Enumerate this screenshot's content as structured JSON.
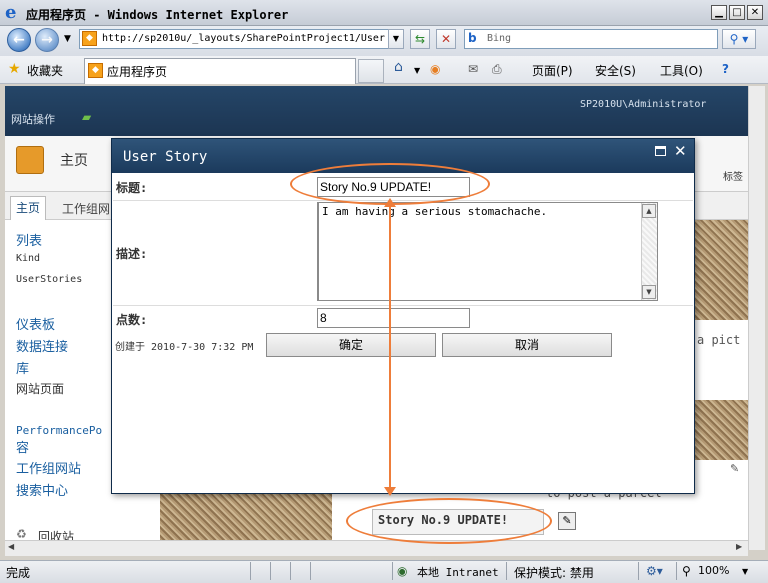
{
  "window": {
    "title": "应用程序页 - Windows Internet Explorer",
    "minimize": "▁",
    "maximize": "□",
    "close": "✕"
  },
  "nav": {
    "back": "←",
    "forward": "→",
    "address": "http://sp2010u/_layouts/SharePointProject1/User",
    "search_placeholder": "Bing"
  },
  "favorites": {
    "label": "收藏夹",
    "tab_label": "应用程序页"
  },
  "commandbar": {
    "page": "页面(P)",
    "safety": "安全(S)",
    "tools": "工具(O)"
  },
  "sharepoint": {
    "user": "SP2010U\\Administrator",
    "site_actions": "网站操作",
    "home_title": "主页",
    "tag_label": "标签",
    "tabs": [
      "主页",
      "工作组网"
    ],
    "nav_lists_header": "列表",
    "nav_lists": [
      "Kind",
      "UserStories"
    ],
    "nav_items": [
      "仪表板",
      "数据连接",
      "库",
      "网站页面"
    ],
    "nav_bottom": [
      "PerformancePo",
      "容",
      "工作组网站",
      "搜索中心"
    ],
    "recycle_bin": "回收站",
    "bg_text_pict": "a pict",
    "bg_text_parcel": "to post a parcel",
    "bg_story_title": "Story No.9 UPDATE!"
  },
  "dialog": {
    "title": "User Story",
    "fields": {
      "title_label": "标题:",
      "title_value": "Story No.9 UPDATE!",
      "desc_label": "描述:",
      "desc_value": "I am having a serious stomachache.",
      "points_label": "点数:",
      "points_value": "8"
    },
    "created": "创建于 2010-7-30 7:32 PM",
    "ok_label": "确定",
    "cancel_label": "取消"
  },
  "status": {
    "left": "完成",
    "zone": "本地 Intranet",
    "protected": "保护模式: 禁用",
    "zoom": "100%"
  },
  "colors": {
    "annotation": "#ee7d3a",
    "dialog_title": "#1b3a5c",
    "sp_ribbon": "#1c3552"
  }
}
